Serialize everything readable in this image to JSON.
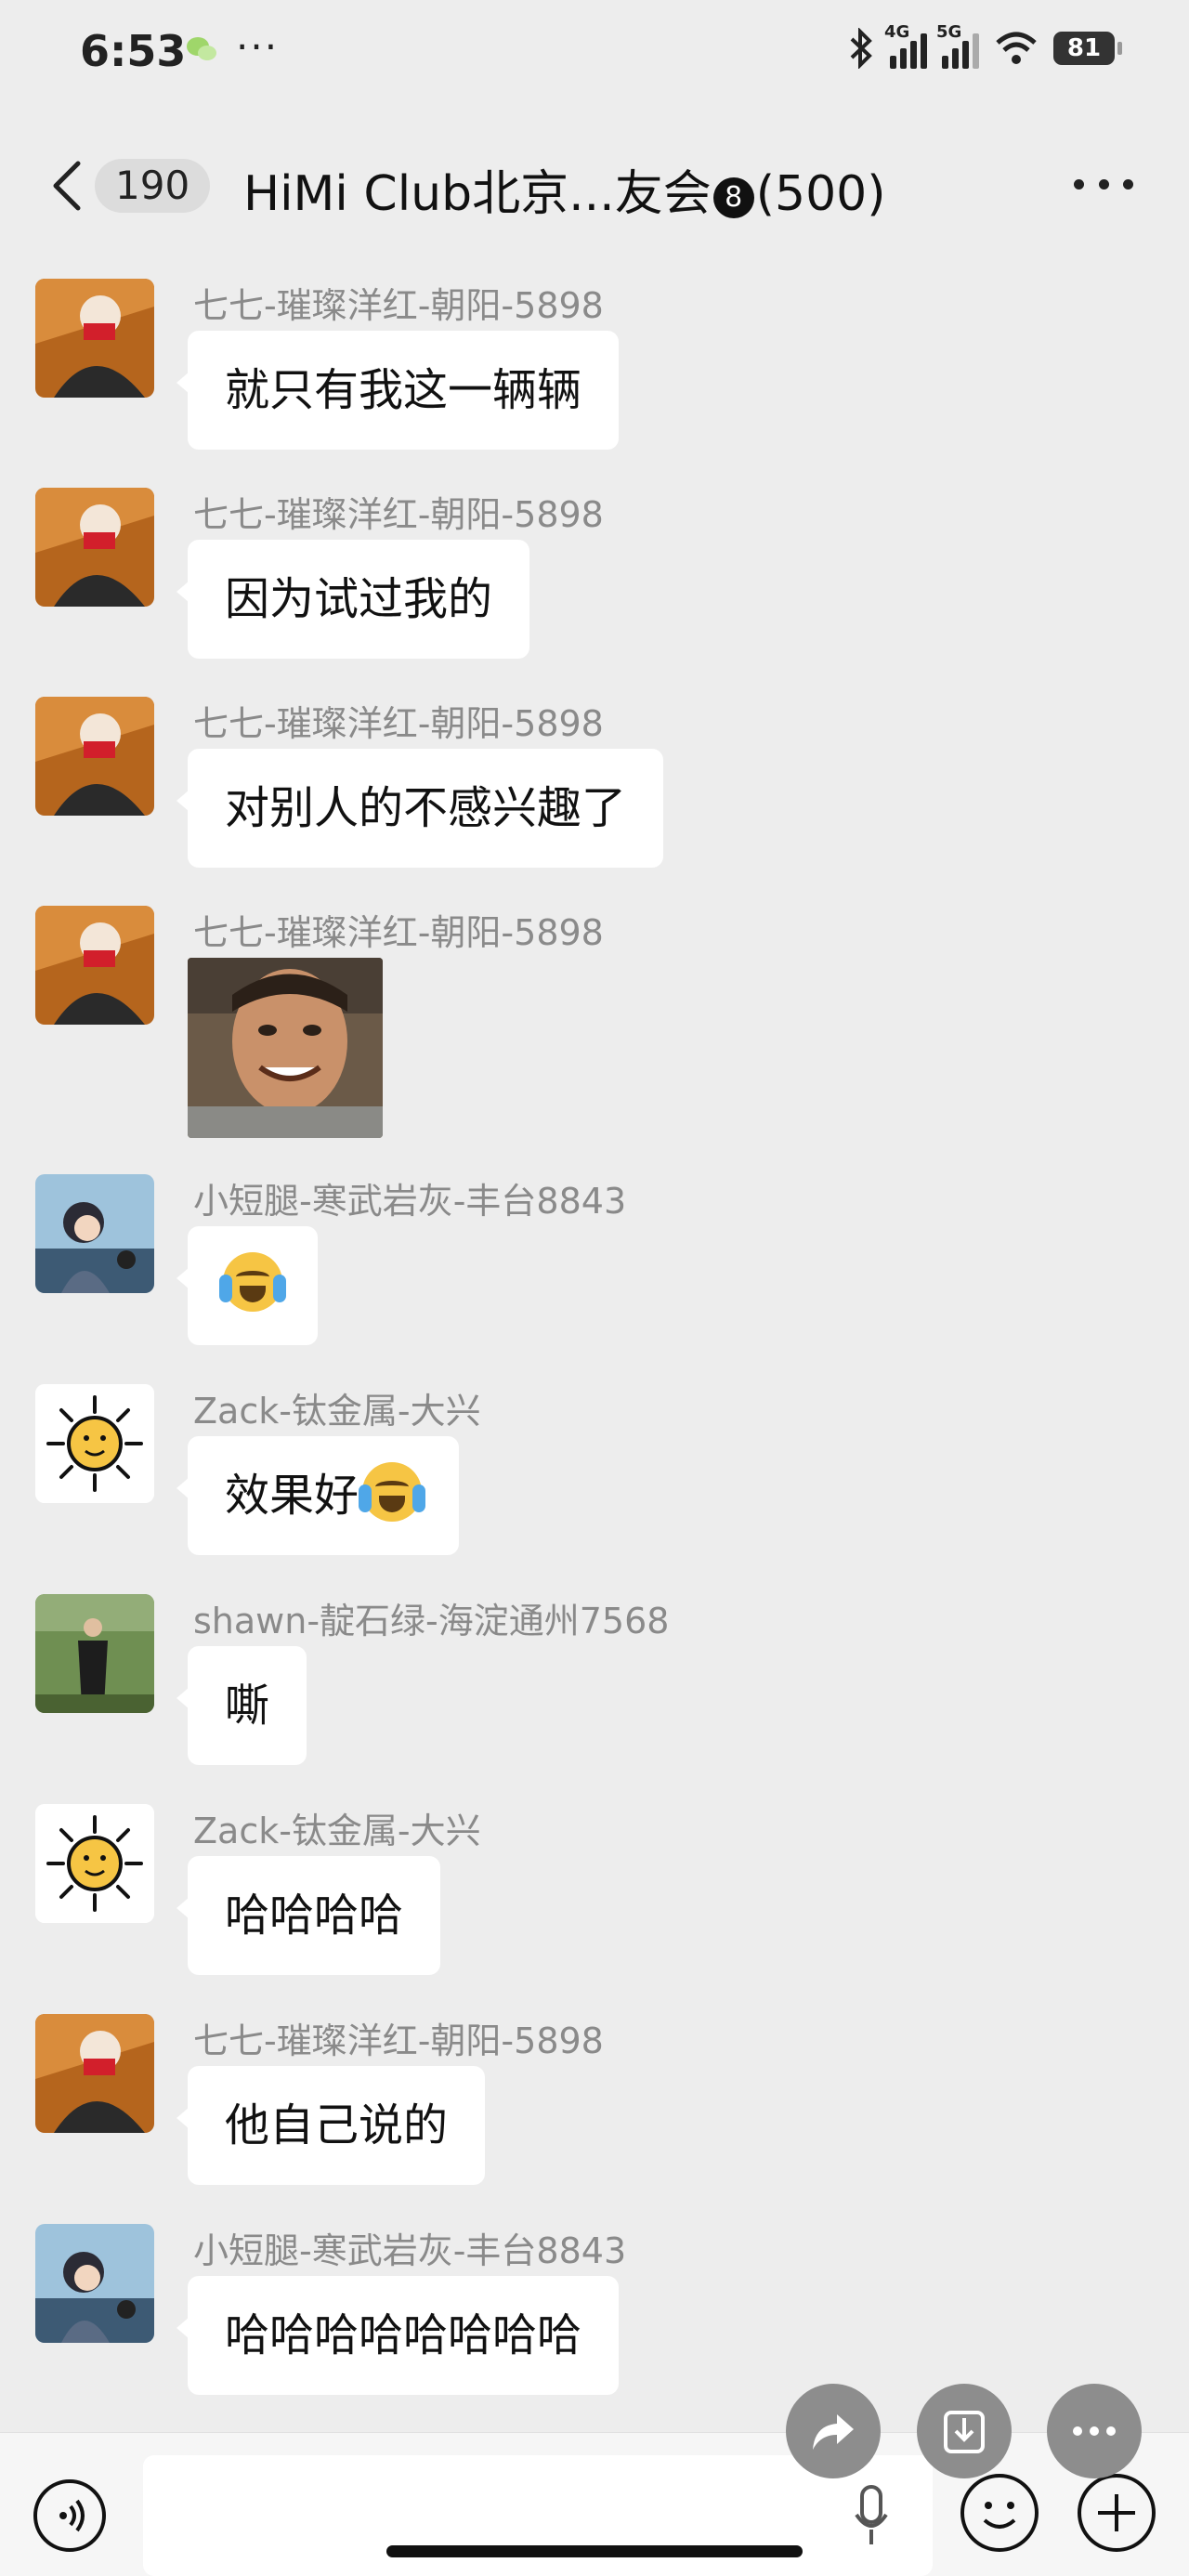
{
  "status_bar": {
    "time": "6:53",
    "more": "···",
    "network1": "4G",
    "network2": "5G",
    "battery": "81"
  },
  "nav": {
    "unread_count": "190",
    "title_prefix": "HiMi Club北京...友会",
    "title_badge": "8",
    "title_suffix": "(500)"
  },
  "messages": [
    {
      "sender": "七七-璀璨洋红-朝阳-5898",
      "text": "就只有我这一辆辆"
    },
    {
      "sender": "七七-璀璨洋红-朝阳-5898",
      "text": "因为试过我的"
    },
    {
      "sender": "七七-璀璨洋红-朝阳-5898",
      "text": "对别人的不感兴趣了"
    },
    {
      "sender": "七七-璀璨洋红-朝阳-5898",
      "text": ""
    },
    {
      "sender": "小短腿-寒武岩灰-丰台8843",
      "text": ""
    },
    {
      "sender": "Zack-钛金属-大兴",
      "text": "效果好"
    },
    {
      "sender": "shawn-靛石绿-海淀通州7568",
      "text": "嘶"
    },
    {
      "sender": "Zack-钛金属-大兴",
      "text": "哈哈哈哈"
    },
    {
      "sender": "七七-璀璨洋红-朝阳-5898",
      "text": "他自己说的"
    },
    {
      "sender": "小短腿-寒武岩灰-丰台8843",
      "text": "哈哈哈哈哈哈哈哈"
    }
  ],
  "colors": {
    "background": "#ededed",
    "bubble": "#ffffff",
    "sender_name": "#8a8a8a",
    "fab": "#8d8d8d"
  },
  "icons": {
    "back": "chevron-left-icon",
    "more": "more-horizontal-icon",
    "forward": "share-forward-icon",
    "save": "download-icon",
    "extra": "more-horizontal-icon",
    "voice": "voice-icon",
    "mic": "microphone-icon",
    "emoji": "emoji-icon",
    "plus": "plus-icon"
  }
}
